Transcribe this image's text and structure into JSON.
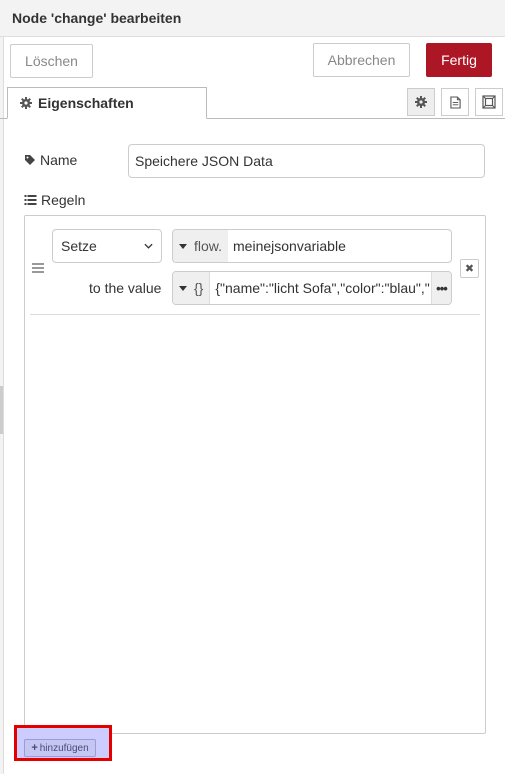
{
  "header": {
    "title": "Node 'change' bearbeiten"
  },
  "toolbar": {
    "delete_label": "Löschen",
    "cancel_label": "Abbrechen",
    "done_label": "Fertig"
  },
  "tabs": {
    "properties_label": "Eigenschaften"
  },
  "form": {
    "name_label": "Name",
    "name_value": "Speichere JSON Data",
    "rules_label": "Regeln"
  },
  "rule": {
    "action": "Setze",
    "property_type": "flow.",
    "property_value": "meinejsonvariable",
    "to_label": "to the value",
    "value_type": "{}",
    "value_value": "{\"name\":\"licht Sofa\",\"color\":\"blau\",\"",
    "expand_label": "•••"
  },
  "add_button": {
    "label": "hinzufügen"
  },
  "colors": {
    "primary": "#ad1625",
    "highlight_border": "#e50000",
    "highlight_fill": "#ccccff"
  },
  "icons": [
    "gear-icon",
    "document-icon",
    "frame-icon",
    "tag-icon",
    "list-icon",
    "drag-handle-icon",
    "remove-icon",
    "chevron-down-icon",
    "caret-down-icon",
    "plus-icon"
  ]
}
